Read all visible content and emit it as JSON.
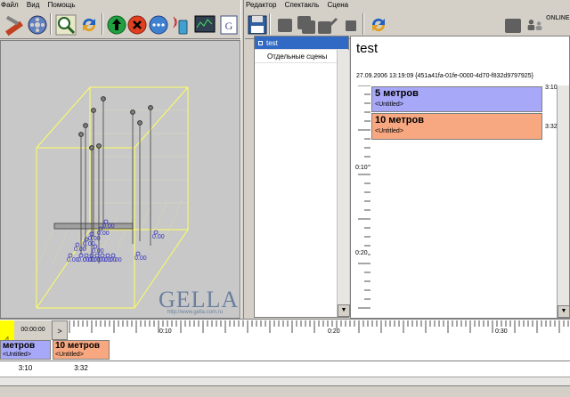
{
  "left_menu": [
    "Файл",
    "Вид",
    "Помощь"
  ],
  "right_menu": [
    "Редактор",
    "Спектакль",
    "Сцена"
  ],
  "online_label": "ONLINE",
  "viewport": {
    "brand": "GELLA",
    "url": "http://www.gella.com.ru",
    "marker_value": "0.00"
  },
  "scenes": {
    "items": [
      "test",
      "Отдельные сцены"
    ],
    "selected": 0
  },
  "detail": {
    "title": "test",
    "meta": "27.09.2006 13:19:09 {451a41fa-01fe-0000-4d70-f832d9797925}",
    "blocks": [
      {
        "title": "5 метров",
        "subtitle": "<Untitled>",
        "duration": "3:10",
        "color": "#a8a8f8"
      },
      {
        "title": "10 метров",
        "subtitle": "<Untitled>",
        "duration": "3:32",
        "color": "#f8a880"
      }
    ],
    "ruler_labels": [
      "0:10",
      "0:20"
    ]
  },
  "timeline": {
    "time_display": "00:00:00",
    "next_label": ">",
    "ruler_labels": [
      "0:10",
      "0:20",
      "0:30"
    ],
    "blocks": [
      {
        "title": "метров",
        "subtitle": "<Untitled>",
        "duration": "3:10",
        "color": "#a8a8f8"
      },
      {
        "title": "10 метров",
        "subtitle": "<Untitled>",
        "duration": "3:32",
        "color": "#f8a880"
      }
    ]
  },
  "colors": {
    "selection": "#316ac5",
    "bounding_box": "#ffff60",
    "marker": "#3030c0",
    "brand_text": "#6a7e9e"
  }
}
